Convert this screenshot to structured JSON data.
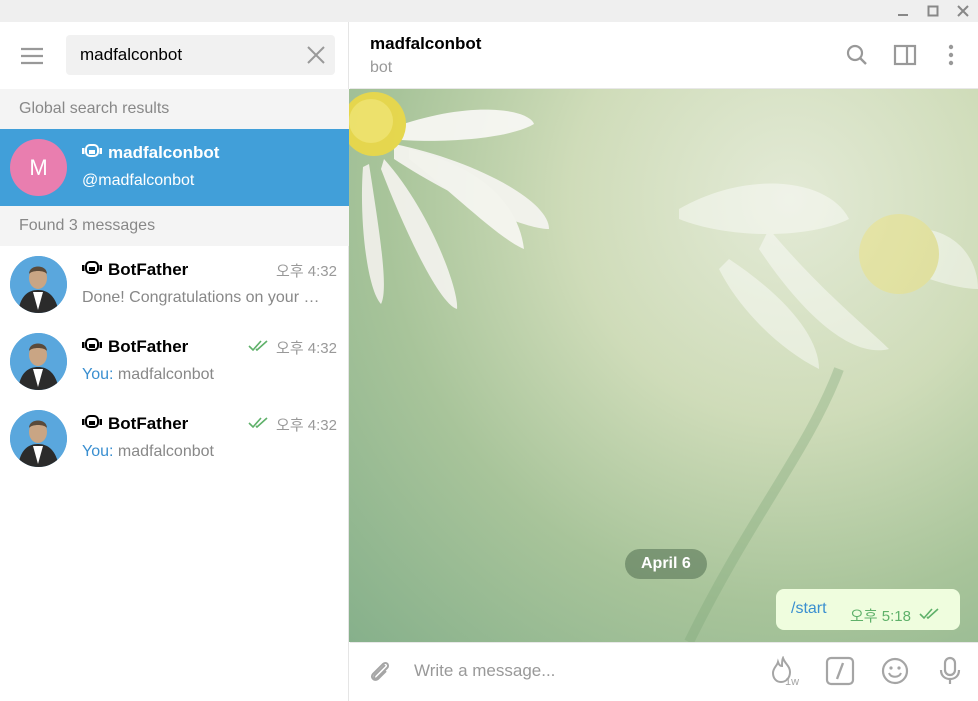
{
  "window": {
    "minimize_icon": "minimize-icon",
    "maximize_icon": "maximize-icon",
    "close_icon": "close-icon"
  },
  "sidebar": {
    "menu_icon": "hamburger-icon",
    "search": {
      "value": "madfalconbot",
      "clear_icon": "close-icon"
    },
    "global_header": "Global search results",
    "global_results": [
      {
        "avatar_letter": "M",
        "avatar_color": "#e97eaf",
        "title": "madfalconbot",
        "subtitle": "@madfalconbot",
        "icon": "bot-icon"
      }
    ],
    "messages_header": "Found 3 messages",
    "messages": [
      {
        "title": "BotFather",
        "time": "오후 4:32",
        "sender": "",
        "text": "Done! Congratulations on your …",
        "read": false
      },
      {
        "title": "BotFather",
        "time": "오후 4:32",
        "sender": "You:",
        "text": "madfalconbot",
        "read": true
      },
      {
        "title": "BotFather",
        "time": "오후 4:32",
        "sender": "You:",
        "text": "madfalconbot",
        "read": true
      }
    ]
  },
  "chat": {
    "title": "madfalconbot",
    "status": "bot",
    "date": "April 6",
    "message": {
      "text": "/start",
      "time": "오후 5:18",
      "read": true
    },
    "composer": {
      "placeholder": "Write a message...",
      "timer_label": "1w"
    }
  },
  "colors": {
    "accent": "#419fd9",
    "outgoing_bubble": "#effdde",
    "read_check": "#5fb16a"
  }
}
